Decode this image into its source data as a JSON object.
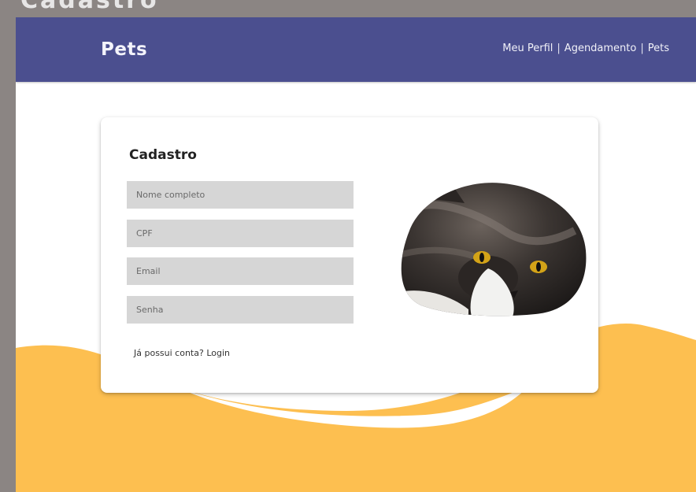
{
  "window": {
    "partial_title": "Cadastro"
  },
  "navbar": {
    "brand": "Pets",
    "links": [
      {
        "label": "Meu Perfil"
      },
      {
        "label": "Agendamento"
      },
      {
        "label": "Pets"
      }
    ],
    "separator": "|"
  },
  "card": {
    "title": "Cadastro",
    "fields": {
      "name_placeholder": "Nome completo",
      "cpf_placeholder": "CPF",
      "email_placeholder": "Email",
      "password_placeholder": "Senha"
    },
    "login_prompt": "Já possui conta?",
    "login_link": "Login"
  },
  "image": {
    "subject": "cat-photo"
  },
  "colors": {
    "navbar": "#4b4f8f",
    "accent_wave": "#fdbf50",
    "field_bg": "#d6d6d6",
    "frame": "#8b8583"
  }
}
